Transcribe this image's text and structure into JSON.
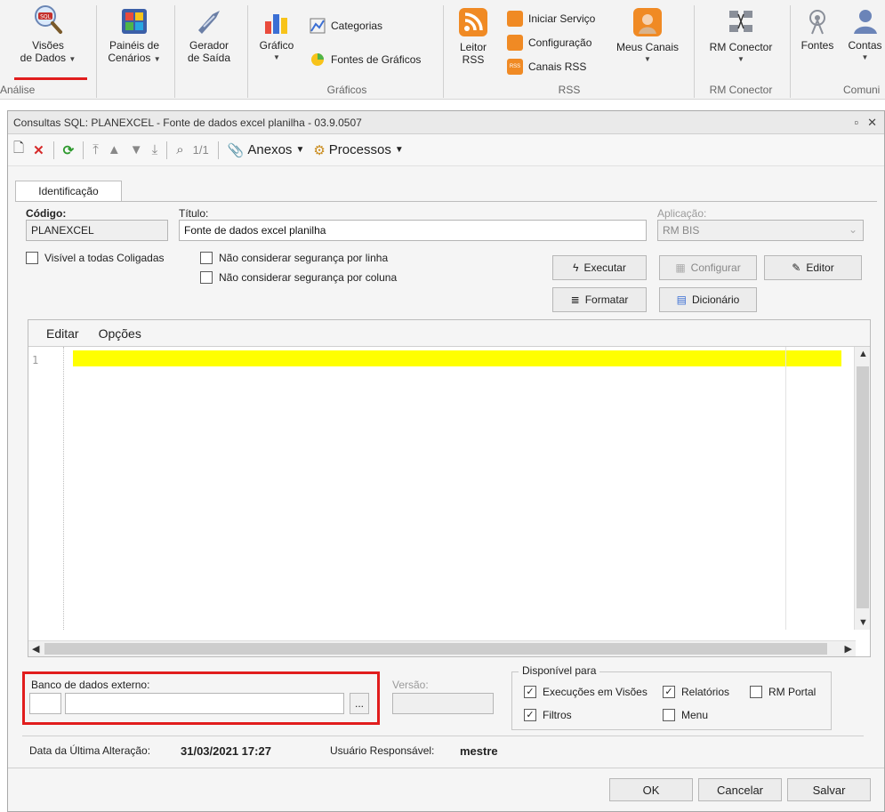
{
  "ribbon": {
    "visoes": {
      "line1": "Visões",
      "line2": "de Dados"
    },
    "paineis": {
      "line1": "Painéis de",
      "line2": "Cenários"
    },
    "gerador": {
      "line1": "Gerador",
      "line2": "de Saída"
    },
    "grafico": "Gráfico",
    "categorias": "Categorias",
    "fontes_graficos": "Fontes de Gráficos",
    "leitor": {
      "line1": "Leitor",
      "line2": "RSS"
    },
    "iniciar": "Iniciar Serviço",
    "configuracao": "Configuração",
    "canais_rss": "Canais RSS",
    "meus_canais": "Meus Canais",
    "rm_conector": "RM Conector",
    "fontes": "Fontes",
    "contas": "Contas",
    "groups": {
      "analise": "Análise",
      "graficos": "Gráficos",
      "rss": "RSS",
      "rm_conector": "RM Conector",
      "comunic": "Comuni"
    },
    "rss_badge": "RSS"
  },
  "dialog": {
    "title": "Consultas SQL: PLANEXCEL - Fonte de dados excel planilha - 03.9.0507",
    "toolbar": {
      "page": "1/1",
      "anexos": "Anexos",
      "processos": "Processos"
    },
    "tab": "Identificação",
    "codigo_label": "Código:",
    "codigo_value": "PLANEXCEL",
    "titulo_label": "Título:",
    "titulo_value": "Fonte de dados excel planilha",
    "aplicacao_label": "Aplicação:",
    "aplicacao_value": "RM BIS",
    "chk_visivel": "Visível a todas Coligadas",
    "chk_seg_linha": "Não considerar segurança por linha",
    "chk_seg_coluna": "Não considerar segurança por coluna",
    "btn_executar": "Executar",
    "btn_configurar": "Configurar",
    "btn_editor": "Editor",
    "btn_formatar": "Formatar",
    "btn_dicionario": "Dicionário",
    "editor": {
      "menu_editar": "Editar",
      "menu_opcoes": "Opções",
      "line": "1"
    },
    "banco_label": "Banco de dados externo:",
    "browse": "...",
    "versao_label": "Versão:",
    "disponivel_label": "Disponível para",
    "chk_exec_visoes": "Execuções em Visões",
    "chk_relatorios": "Relatórios",
    "chk_rm_portal": "RM Portal",
    "chk_filtros": "Filtros",
    "chk_menu": "Menu",
    "data_label": "Data da Última Alteração:",
    "data_value": "31/03/2021 17:27",
    "usuario_label": "Usuário Responsável:",
    "usuario_value": "mestre",
    "btn_ok": "OK",
    "btn_cancelar": "Cancelar",
    "btn_salvar": "Salvar"
  },
  "icons": [
    "sql-magnifier-icon",
    "dashboard-icon",
    "output-generator-icon",
    "chart-icon",
    "categories-icon",
    "chart-sources-icon",
    "rss-icon",
    "start-service-icon",
    "configuration-icon",
    "rss-channels-icon",
    "my-channels-icon",
    "connector-icon",
    "sources-icon",
    "accounts-icon"
  ],
  "colors": {
    "highlight": "#ffff00",
    "annotation_red": "#e11d1d",
    "rss_orange": "#f08a24"
  }
}
